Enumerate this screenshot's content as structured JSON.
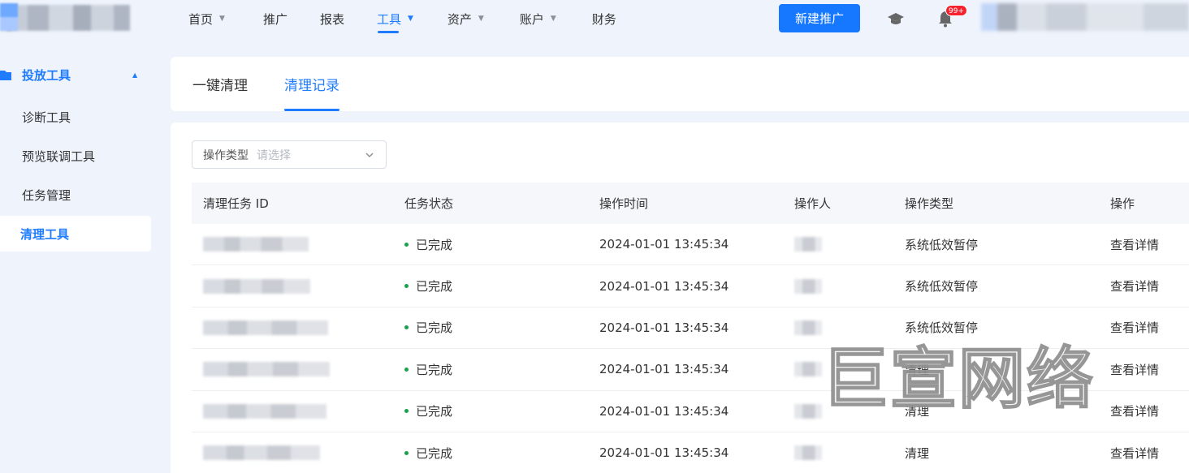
{
  "header": {
    "nav": [
      {
        "label": "首页",
        "dropdown": true
      },
      {
        "label": "推广",
        "dropdown": false
      },
      {
        "label": "报表",
        "dropdown": false
      },
      {
        "label": "工具",
        "dropdown": true,
        "active": true
      },
      {
        "label": "资产",
        "dropdown": true
      },
      {
        "label": "账户",
        "dropdown": true
      },
      {
        "label": "财务",
        "dropdown": false
      }
    ],
    "new_button": "新建推广",
    "notification_badge": "99+",
    "accent": "#1677ff"
  },
  "sidebar": {
    "group_label": "投放工具",
    "items": [
      {
        "label": "诊断工具"
      },
      {
        "label": "预览联调工具"
      },
      {
        "label": "任务管理"
      },
      {
        "label": "清理工具",
        "active": true
      }
    ]
  },
  "tabs": [
    {
      "label": "一键清理"
    },
    {
      "label": "清理记录",
      "active": true
    }
  ],
  "filter": {
    "label": "操作类型",
    "placeholder": "请选择"
  },
  "table": {
    "columns": [
      "清理任务 ID",
      "任务状态",
      "操作时间",
      "操作人",
      "操作类型",
      "操作"
    ],
    "rows": [
      {
        "status": "已完成",
        "time": "2024-01-01 13:45:34",
        "type": "系统低效暂停",
        "action": "查看详情"
      },
      {
        "status": "已完成",
        "time": "2024-01-01 13:45:34",
        "type": "系统低效暂停",
        "action": "查看详情"
      },
      {
        "status": "已完成",
        "time": "2024-01-01 13:45:34",
        "type": "系统低效暂停",
        "action": "查看详情"
      },
      {
        "status": "已完成",
        "time": "2024-01-01 13:45:34",
        "type": "清理",
        "action": "查看详情"
      },
      {
        "status": "已完成",
        "time": "2024-01-01 13:45:34",
        "type": "清理",
        "action": "查看详情"
      },
      {
        "status": "已完成",
        "time": "2024-01-01 13:45:34",
        "type": "清理",
        "action": "查看详情"
      }
    ],
    "status_color": "#17a34a"
  },
  "watermark": "巨宣网络"
}
